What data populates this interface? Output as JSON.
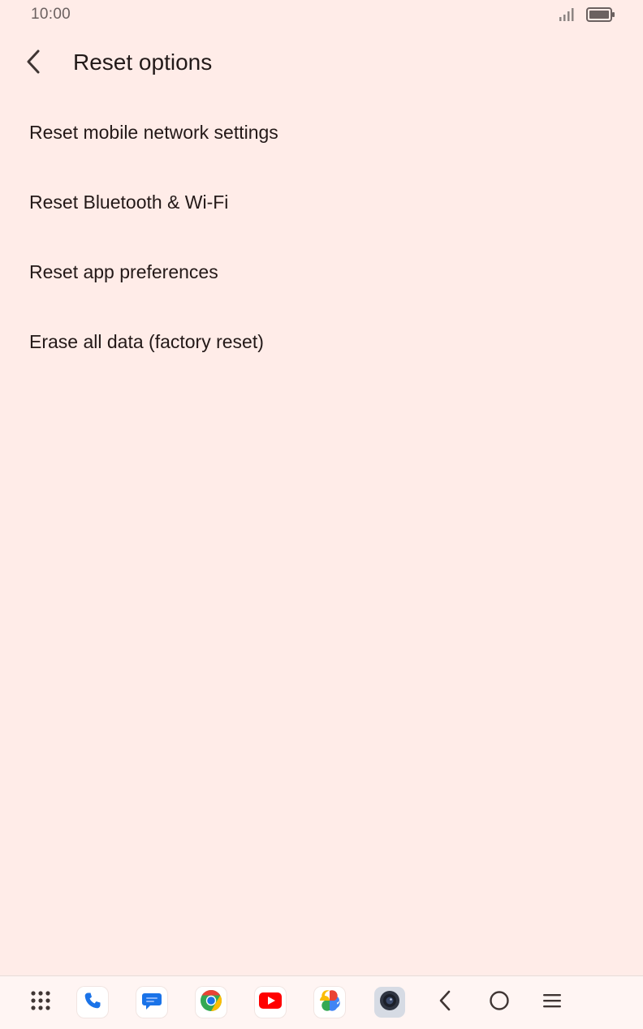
{
  "status_bar": {
    "time": "10:00",
    "signal_icon": "signal-icon",
    "battery_icon": "battery-icon"
  },
  "header": {
    "back_icon": "back-arrow-icon",
    "title": "Reset options"
  },
  "options": [
    {
      "label": "Reset mobile network settings"
    },
    {
      "label": "Reset Bluetooth & Wi-Fi"
    },
    {
      "label": "Reset app preferences"
    },
    {
      "label": "Erase all data (factory reset)"
    }
  ],
  "nav_bar": {
    "items": [
      {
        "icon": "app-grid-icon"
      },
      {
        "icon": "phone-app-icon"
      },
      {
        "icon": "messages-app-icon"
      },
      {
        "icon": "chrome-app-icon"
      },
      {
        "icon": "youtube-app-icon"
      },
      {
        "icon": "photos-app-icon"
      },
      {
        "icon": "camera-app-icon"
      },
      {
        "icon": "back-nav-icon"
      },
      {
        "icon": "home-nav-icon"
      },
      {
        "icon": "recents-nav-icon"
      }
    ]
  },
  "colors": {
    "background": "#ffece8",
    "text": "#221a19",
    "nav_background": "#fff5f3"
  }
}
